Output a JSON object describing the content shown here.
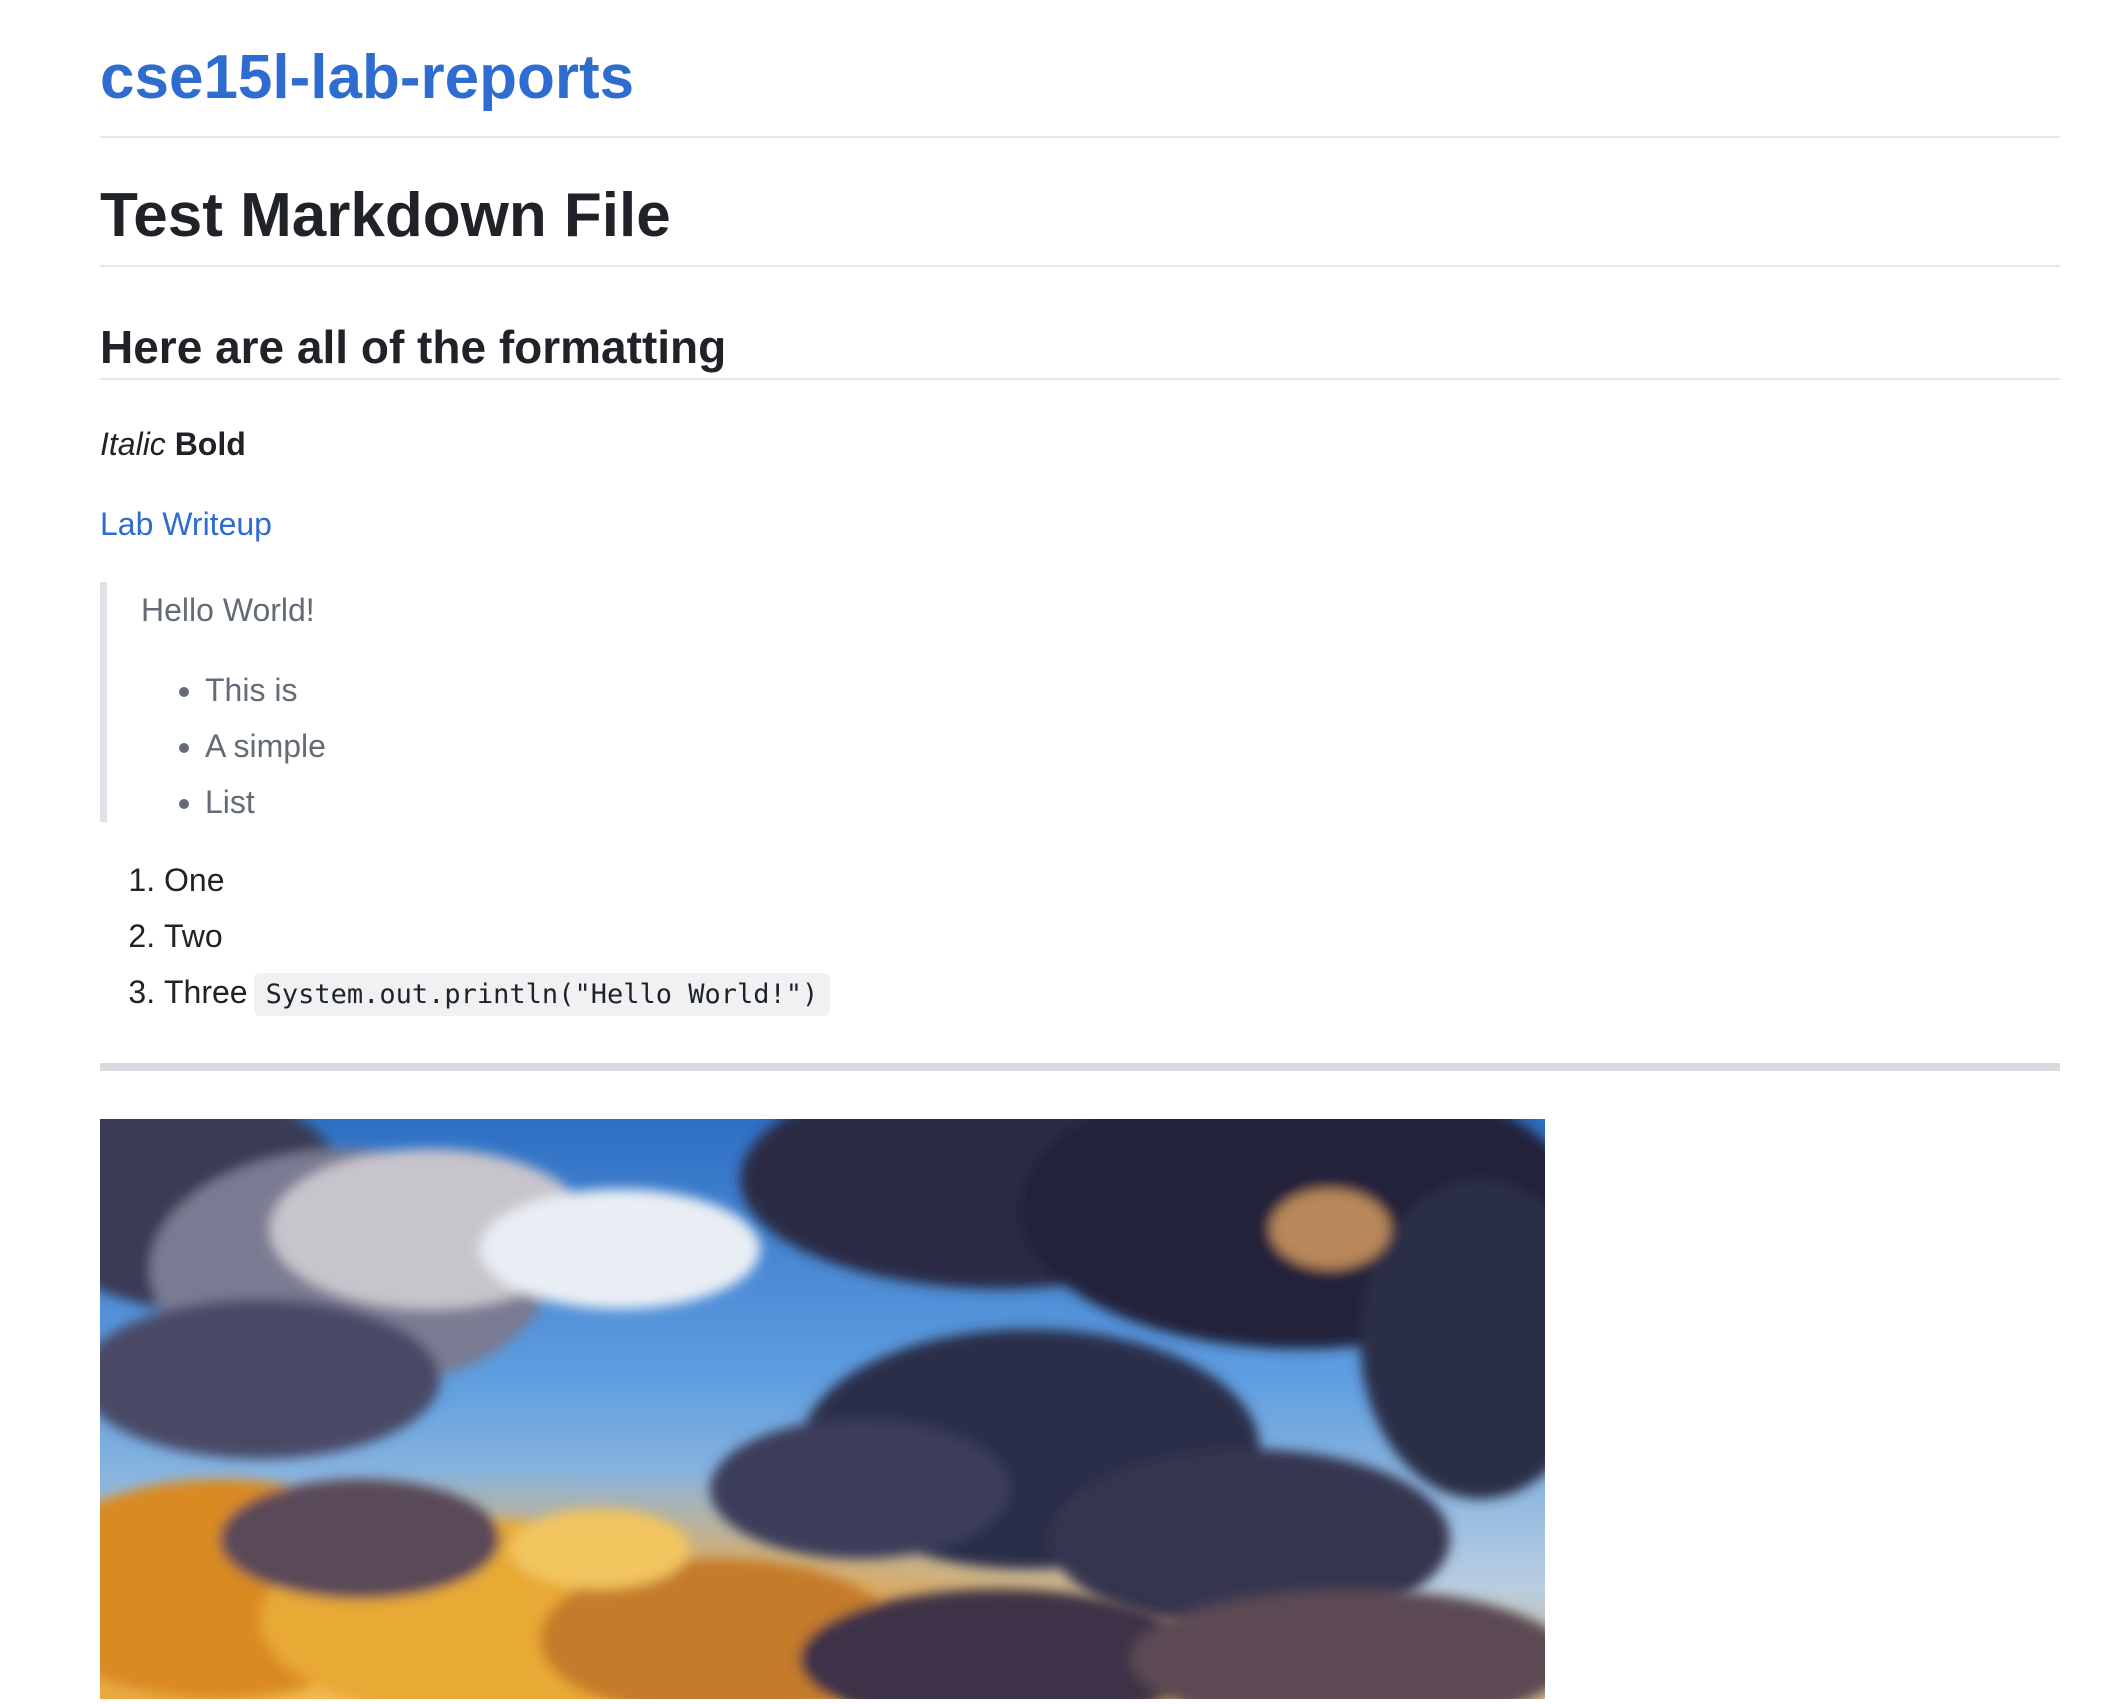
{
  "site": {
    "title": "cse15l-lab-reports"
  },
  "doc": {
    "title": "Test Markdown File",
    "section_heading": "Here are all of the formatting",
    "italic_text": "Italic",
    "bold_text": "Bold",
    "link_text": "Lab Writeup",
    "blockquote": {
      "text": "Hello World!",
      "items": [
        "This is",
        "A simple",
        "List"
      ]
    },
    "ordered_list": {
      "items": [
        "One",
        "Two",
        "Three"
      ],
      "code_snippet": "System.out.println(\"Hello World!\")"
    }
  },
  "colors": {
    "link": "#2f6ccf",
    "text": "#1f2328",
    "muted": "#636c76",
    "divider": "#e5e7ea"
  }
}
